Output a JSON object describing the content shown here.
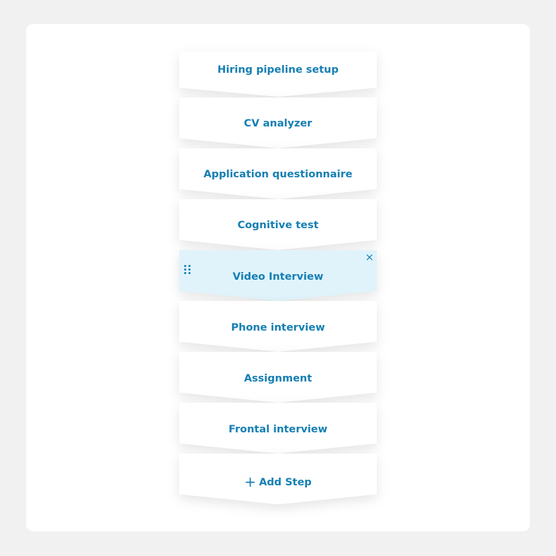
{
  "steps": [
    {
      "label": "Hiring pipeline setup"
    },
    {
      "label": "CV analyzer"
    },
    {
      "label": "Application questionnaire"
    },
    {
      "label": "Cognitive test"
    },
    {
      "label": "Video Interview",
      "active": true
    },
    {
      "label": "Phone interview"
    },
    {
      "label": "Assignment"
    },
    {
      "label": "Frontal interview"
    }
  ],
  "add_step": {
    "icon": "+",
    "label": "Add Step"
  },
  "close_icon": "×",
  "colors": {
    "accent": "#157fb3",
    "active_bg": "#e0f3fb",
    "page_bg": "#f1f1f1"
  }
}
